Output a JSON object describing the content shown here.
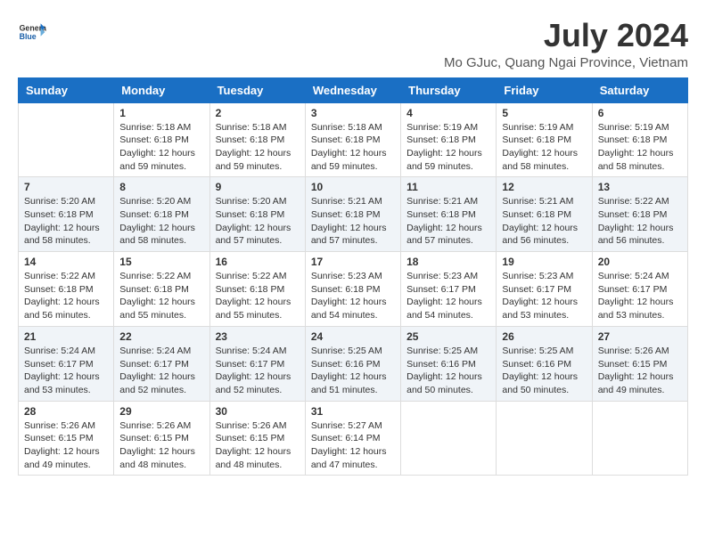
{
  "logo": {
    "name": "GeneralBlue",
    "line1": "General",
    "line2": "Blue"
  },
  "title": "July 2024",
  "location": "Mo GJuc, Quang Ngai Province, Vietnam",
  "days_of_week": [
    "Sunday",
    "Monday",
    "Tuesday",
    "Wednesday",
    "Thursday",
    "Friday",
    "Saturday"
  ],
  "weeks": [
    [
      {
        "day": "",
        "info": ""
      },
      {
        "day": "1",
        "info": "Sunrise: 5:18 AM\nSunset: 6:18 PM\nDaylight: 12 hours\nand 59 minutes."
      },
      {
        "day": "2",
        "info": "Sunrise: 5:18 AM\nSunset: 6:18 PM\nDaylight: 12 hours\nand 59 minutes."
      },
      {
        "day": "3",
        "info": "Sunrise: 5:18 AM\nSunset: 6:18 PM\nDaylight: 12 hours\nand 59 minutes."
      },
      {
        "day": "4",
        "info": "Sunrise: 5:19 AM\nSunset: 6:18 PM\nDaylight: 12 hours\nand 59 minutes."
      },
      {
        "day": "5",
        "info": "Sunrise: 5:19 AM\nSunset: 6:18 PM\nDaylight: 12 hours\nand 58 minutes."
      },
      {
        "day": "6",
        "info": "Sunrise: 5:19 AM\nSunset: 6:18 PM\nDaylight: 12 hours\nand 58 minutes."
      }
    ],
    [
      {
        "day": "7",
        "info": "Sunrise: 5:20 AM\nSunset: 6:18 PM\nDaylight: 12 hours\nand 58 minutes."
      },
      {
        "day": "8",
        "info": "Sunrise: 5:20 AM\nSunset: 6:18 PM\nDaylight: 12 hours\nand 58 minutes."
      },
      {
        "day": "9",
        "info": "Sunrise: 5:20 AM\nSunset: 6:18 PM\nDaylight: 12 hours\nand 57 minutes."
      },
      {
        "day": "10",
        "info": "Sunrise: 5:21 AM\nSunset: 6:18 PM\nDaylight: 12 hours\nand 57 minutes."
      },
      {
        "day": "11",
        "info": "Sunrise: 5:21 AM\nSunset: 6:18 PM\nDaylight: 12 hours\nand 57 minutes."
      },
      {
        "day": "12",
        "info": "Sunrise: 5:21 AM\nSunset: 6:18 PM\nDaylight: 12 hours\nand 56 minutes."
      },
      {
        "day": "13",
        "info": "Sunrise: 5:22 AM\nSunset: 6:18 PM\nDaylight: 12 hours\nand 56 minutes."
      }
    ],
    [
      {
        "day": "14",
        "info": "Sunrise: 5:22 AM\nSunset: 6:18 PM\nDaylight: 12 hours\nand 56 minutes."
      },
      {
        "day": "15",
        "info": "Sunrise: 5:22 AM\nSunset: 6:18 PM\nDaylight: 12 hours\nand 55 minutes."
      },
      {
        "day": "16",
        "info": "Sunrise: 5:22 AM\nSunset: 6:18 PM\nDaylight: 12 hours\nand 55 minutes."
      },
      {
        "day": "17",
        "info": "Sunrise: 5:23 AM\nSunset: 6:18 PM\nDaylight: 12 hours\nand 54 minutes."
      },
      {
        "day": "18",
        "info": "Sunrise: 5:23 AM\nSunset: 6:17 PM\nDaylight: 12 hours\nand 54 minutes."
      },
      {
        "day": "19",
        "info": "Sunrise: 5:23 AM\nSunset: 6:17 PM\nDaylight: 12 hours\nand 53 minutes."
      },
      {
        "day": "20",
        "info": "Sunrise: 5:24 AM\nSunset: 6:17 PM\nDaylight: 12 hours\nand 53 minutes."
      }
    ],
    [
      {
        "day": "21",
        "info": "Sunrise: 5:24 AM\nSunset: 6:17 PM\nDaylight: 12 hours\nand 53 minutes."
      },
      {
        "day": "22",
        "info": "Sunrise: 5:24 AM\nSunset: 6:17 PM\nDaylight: 12 hours\nand 52 minutes."
      },
      {
        "day": "23",
        "info": "Sunrise: 5:24 AM\nSunset: 6:17 PM\nDaylight: 12 hours\nand 52 minutes."
      },
      {
        "day": "24",
        "info": "Sunrise: 5:25 AM\nSunset: 6:16 PM\nDaylight: 12 hours\nand 51 minutes."
      },
      {
        "day": "25",
        "info": "Sunrise: 5:25 AM\nSunset: 6:16 PM\nDaylight: 12 hours\nand 50 minutes."
      },
      {
        "day": "26",
        "info": "Sunrise: 5:25 AM\nSunset: 6:16 PM\nDaylight: 12 hours\nand 50 minutes."
      },
      {
        "day": "27",
        "info": "Sunrise: 5:26 AM\nSunset: 6:15 PM\nDaylight: 12 hours\nand 49 minutes."
      }
    ],
    [
      {
        "day": "28",
        "info": "Sunrise: 5:26 AM\nSunset: 6:15 PM\nDaylight: 12 hours\nand 49 minutes."
      },
      {
        "day": "29",
        "info": "Sunrise: 5:26 AM\nSunset: 6:15 PM\nDaylight: 12 hours\nand 48 minutes."
      },
      {
        "day": "30",
        "info": "Sunrise: 5:26 AM\nSunset: 6:15 PM\nDaylight: 12 hours\nand 48 minutes."
      },
      {
        "day": "31",
        "info": "Sunrise: 5:27 AM\nSunset: 6:14 PM\nDaylight: 12 hours\nand 47 minutes."
      },
      {
        "day": "",
        "info": ""
      },
      {
        "day": "",
        "info": ""
      },
      {
        "day": "",
        "info": ""
      }
    ]
  ]
}
